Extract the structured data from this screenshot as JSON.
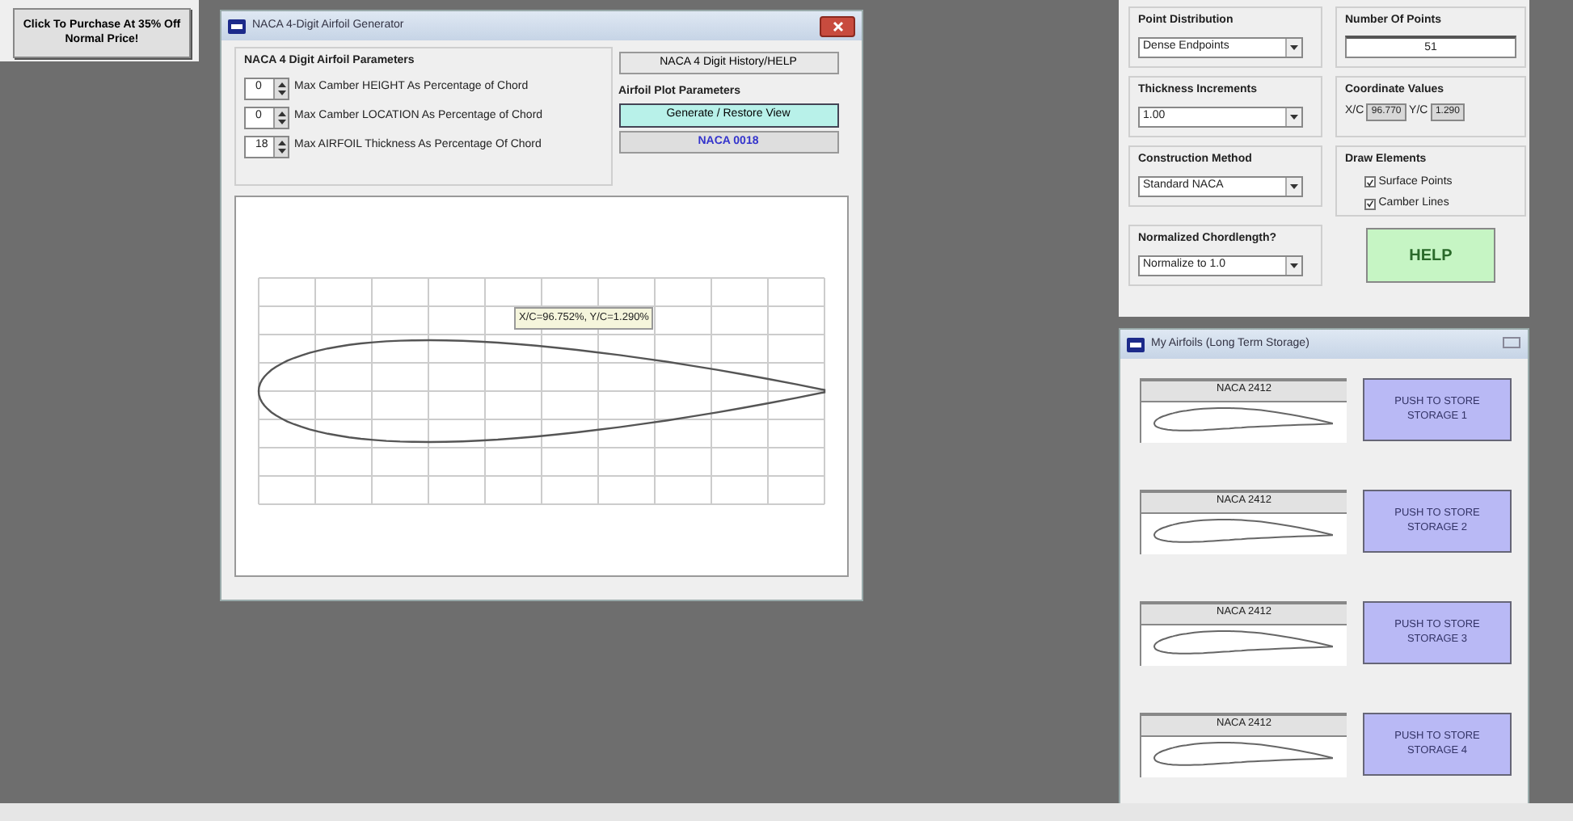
{
  "promo_panel": {
    "button": "Click To Purchase At 35% Off Normal Price!"
  },
  "generator_window": {
    "title": "NACA 4-Digit Airfoil Generator",
    "parameters_group": {
      "title": "NACA 4 Digit Airfoil Parameters",
      "spinners": [
        {
          "value": "0",
          "label": "Max Camber HEIGHT As Percentage of Chord"
        },
        {
          "value": "0",
          "label": "Max Camber LOCATION As Percentage of Chord"
        },
        {
          "value": "18",
          "label": "Max AIRFOIL Thickness As Percentage Of Chord"
        }
      ]
    },
    "history_button": "NACA 4 Digit History/HELP",
    "plot_parameters": {
      "title": "Airfoil Plot Parameters",
      "buttons": [
        {
          "label": "Generate / Restore View",
          "kind": "action"
        },
        {
          "label": "NACA 0018",
          "kind": "name"
        }
      ]
    },
    "plot": {
      "tooltip": "X/C=96.752%, Y/C=1.290%"
    }
  },
  "options_panel": {
    "groups": [
      {
        "kind": "select",
        "title": "Point Distribution",
        "value": "Dense Endpoints"
      },
      {
        "kind": "number",
        "title": "Number Of Points",
        "value": "51"
      },
      {
        "kind": "select",
        "title": "Thickness Increments",
        "value": "1.00"
      },
      {
        "kind": "coords",
        "title": "Coordinate Values",
        "fields": [
          {
            "label": "X/C",
            "value": "96.770"
          },
          {
            "label": "Y/C",
            "value": "1.290"
          }
        ]
      },
      {
        "kind": "select",
        "title": "Construction Method",
        "value": "Standard NACA"
      },
      {
        "kind": "checks",
        "title": "Draw Elements",
        "items": [
          {
            "label": "Surface Points",
            "checked": true
          },
          {
            "label": "Camber Lines",
            "checked": true
          }
        ]
      },
      {
        "kind": "select",
        "title": "Normalized Chordlength?",
        "value": "Normalize to 1.0"
      },
      {
        "kind": "help",
        "title": "HELP"
      }
    ]
  },
  "storage_window": {
    "title": "My Airfoils (Long Term Storage)",
    "slots": [
      {
        "name": "NACA 2412",
        "button": "PUSH TO STORE STORAGE 1"
      },
      {
        "name": "NACA 2412",
        "button": "PUSH TO STORE STORAGE 2"
      },
      {
        "name": "NACA 2412",
        "button": "PUSH TO STORE STORAGE 3"
      },
      {
        "name": "NACA 2412",
        "button": "PUSH TO STORE STORAGE 4"
      }
    ]
  }
}
